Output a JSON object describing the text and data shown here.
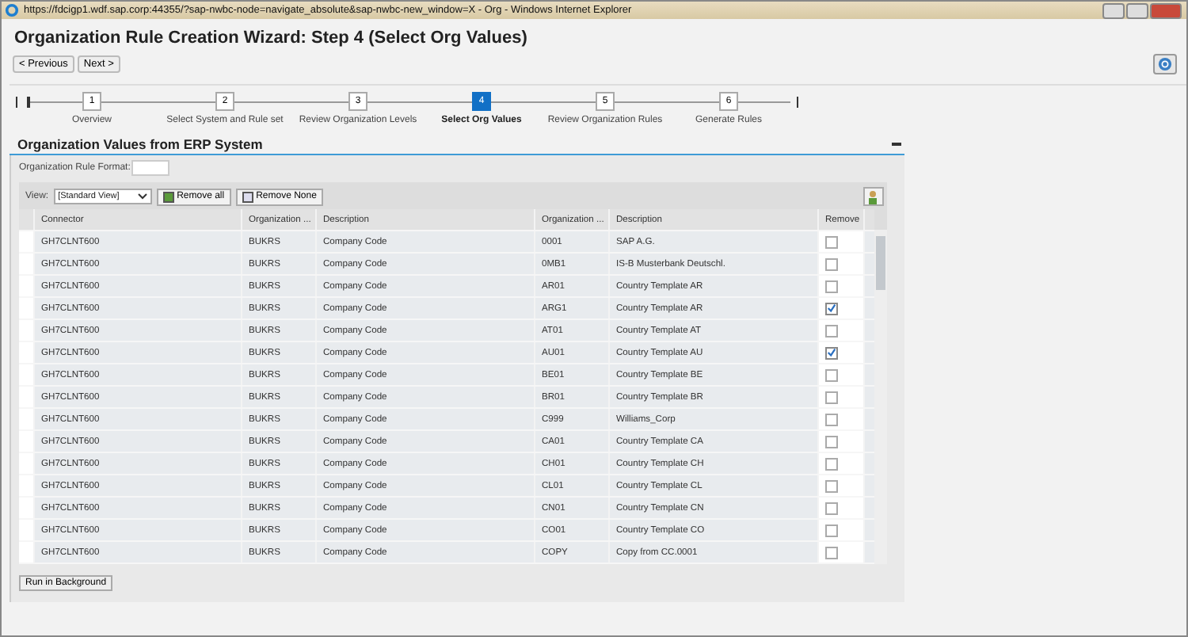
{
  "browser": {
    "title": "https://fdcigp1.wdf.sap.corp:44355/?sap-nwbc-node=navigate_absolute&sap-nwbc-new_window=X - Org - Windows Internet Explorer"
  },
  "page": {
    "title": "Organization Rule Creation Wizard: Step 4  (Select Org Values)",
    "buttons": [
      "< Previous",
      "Next >"
    ]
  },
  "steps": [
    {
      "number": "1",
      "label": "Overview",
      "selected": false
    },
    {
      "number": "2",
      "label": "Select System and Rule set",
      "selected": false
    },
    {
      "number": "3",
      "label": "Review Organization Levels",
      "selected": false
    },
    {
      "number": "4",
      "label": "Select Org Values",
      "selected": true
    },
    {
      "number": "5",
      "label": "Review Organization Rules",
      "selected": false
    },
    {
      "number": "6",
      "label": "Generate Rules",
      "selected": false
    }
  ],
  "section": {
    "title": "Organization Values from ERP System",
    "format_label": "Organization Rule Format:",
    "view_label": "View:",
    "view_value": "[Standard View]",
    "toolbar_buttons": [
      "Remove all",
      "Remove None"
    ],
    "columns": [
      "Connector",
      "Organization ...",
      "Description",
      "Organization ...",
      "Description",
      "Remove"
    ],
    "rows": [
      {
        "connector": "GH7CLNT600",
        "field": "BUKRS",
        "field_desc": "Company Code",
        "value": "0001",
        "value_desc": "SAP A.G.",
        "checked": false
      },
      {
        "connector": "GH7CLNT600",
        "field": "BUKRS",
        "field_desc": "Company Code",
        "value": "0MB1",
        "value_desc": "IS-B Musterbank Deutschl.",
        "checked": false
      },
      {
        "connector": "GH7CLNT600",
        "field": "BUKRS",
        "field_desc": "Company Code",
        "value": "AR01",
        "value_desc": "Country Template AR",
        "checked": false
      },
      {
        "connector": "GH7CLNT600",
        "field": "BUKRS",
        "field_desc": "Company Code",
        "value": "ARG1",
        "value_desc": "Country Template AR",
        "checked": true
      },
      {
        "connector": "GH7CLNT600",
        "field": "BUKRS",
        "field_desc": "Company Code",
        "value": "AT01",
        "value_desc": "Country Template AT",
        "checked": false
      },
      {
        "connector": "GH7CLNT600",
        "field": "BUKRS",
        "field_desc": "Company Code",
        "value": "AU01",
        "value_desc": "Country Template AU",
        "checked": true
      },
      {
        "connector": "GH7CLNT600",
        "field": "BUKRS",
        "field_desc": "Company Code",
        "value": "BE01",
        "value_desc": "Country Template BE",
        "checked": false
      },
      {
        "connector": "GH7CLNT600",
        "field": "BUKRS",
        "field_desc": "Company Code",
        "value": "BR01",
        "value_desc": "Country Template BR",
        "checked": false
      },
      {
        "connector": "GH7CLNT600",
        "field": "BUKRS",
        "field_desc": "Company Code",
        "value": "C999",
        "value_desc": "Williams_Corp",
        "checked": false
      },
      {
        "connector": "GH7CLNT600",
        "field": "BUKRS",
        "field_desc": "Company Code",
        "value": "CA01",
        "value_desc": "Country Template CA",
        "checked": false
      },
      {
        "connector": "GH7CLNT600",
        "field": "BUKRS",
        "field_desc": "Company Code",
        "value": "CH01",
        "value_desc": "Country Template CH",
        "checked": false
      },
      {
        "connector": "GH7CLNT600",
        "field": "BUKRS",
        "field_desc": "Company Code",
        "value": "CL01",
        "value_desc": "Country Template CL",
        "checked": false
      },
      {
        "connector": "GH7CLNT600",
        "field": "BUKRS",
        "field_desc": "Company Code",
        "value": "CN01",
        "value_desc": "Country Template CN",
        "checked": false
      },
      {
        "connector": "GH7CLNT600",
        "field": "BUKRS",
        "field_desc": "Company Code",
        "value": "CO01",
        "value_desc": "Country Template CO",
        "checked": false
      },
      {
        "connector": "GH7CLNT600",
        "field": "BUKRS",
        "field_desc": "Company Code",
        "value": "COPY",
        "value_desc": "Copy from CC.0001",
        "checked": false
      }
    ],
    "footer_button": "Run in Background"
  }
}
